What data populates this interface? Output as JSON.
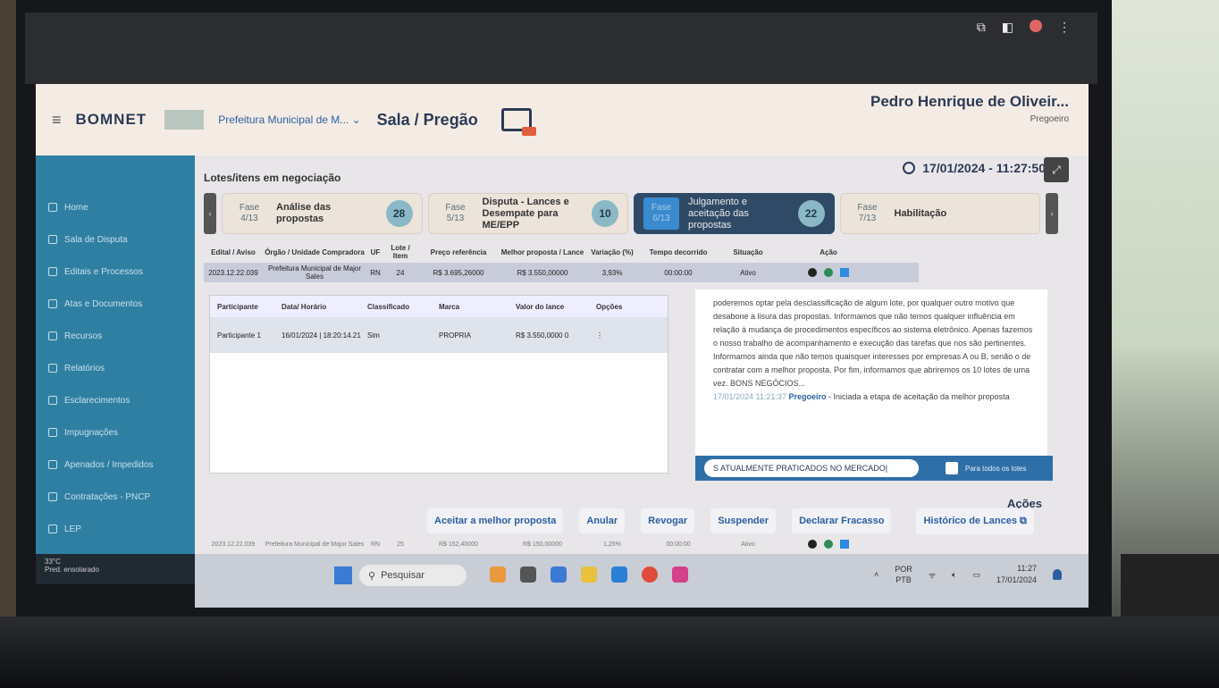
{
  "app": {
    "logo": "BOMNET",
    "org_select": "Prefeitura Municipal de M... ⌄",
    "page_heading": "Sala / Pregão",
    "user_name": "Pedro Henrique de Oliveir...",
    "user_role": "Pregoeiro"
  },
  "sidebar": {
    "items": [
      {
        "label": "Home"
      },
      {
        "label": "Sala de Disputa"
      },
      {
        "label": "Editais e Processos"
      },
      {
        "label": "Atas e Documentos"
      },
      {
        "label": "Recursos"
      },
      {
        "label": "Relatórios"
      },
      {
        "label": "Esclarecimentos"
      },
      {
        "label": "Impugnações"
      },
      {
        "label": "Apenados / Impedidos"
      },
      {
        "label": "Contratações - PNCP"
      },
      {
        "label": "LEP"
      }
    ]
  },
  "main": {
    "title": "Lotes/itens em negociação",
    "datetime": "17/01/2024 - 11:27:50",
    "phases": [
      {
        "label": "Fase 4/13",
        "name": "Análise das propostas",
        "count": "28"
      },
      {
        "label": "Fase 5/13",
        "name": "Disputa - Lances e Desempate para ME/EPP",
        "count": "10"
      },
      {
        "label": "Fase 6/13",
        "name": "Julgamento e aceitação das propostas",
        "count": "22"
      },
      {
        "label": "Fase 7/13",
        "name": "Habilitação",
        "count": ""
      }
    ],
    "lot_headers": [
      "Edital / Aviso",
      "Órgão / Unidade Compradora",
      "UF",
      "Lote / Item",
      "Preço referência",
      "Melhor proposta / Lance",
      "Variação (%)",
      "Tempo decorrido",
      "Situação",
      "Ação"
    ],
    "lot_row": [
      "2023.12.22.039",
      "Prefeitura Municipal de Major Sales",
      "RN",
      "24",
      "R$ 3.695,26000",
      "R$ 3.550,00000",
      "3,93%",
      "00:00:00",
      "Ativo"
    ],
    "lot_row2": [
      "2023.12.22.039",
      "Prefeitura Municipal de Major Sales",
      "RN",
      "25",
      "R$ 152,40000",
      "R$ 150,00000",
      "1,25%",
      "00:00:00",
      "Ativo"
    ],
    "bid_headers": [
      "Participante",
      "Data/ Horário",
      "Classificado",
      "Marca",
      "Valor do lance",
      "Opções"
    ],
    "bid_row": [
      "Participante 1",
      "16/01/2024 | 18:20:14.21",
      "Sim",
      "PROPRIA",
      "R$ 3.550,0000 0",
      "⋮"
    ],
    "chat_text": "poderemos optar pela desclassificação de algum lote, por qualquer outro motivo que desabone a lisura das propostas. Informamos que não temos qualquer influência em relação à mudança de procedimentos específicos ao sistema eletrônico. Apenas fazemos o nosso trabalho de acompanhamento e execução das tarefas que nos são pertinentes. Informamos ainda que não temos quaisquer interesses por empresas A ou B, senão o de contratar com a melhor proposta. Por fim, informamos que abriremos os 10 lotes de uma vez. BONS NEGÓCIOS...",
    "chat_time": "17/01/2024 11:21:37",
    "chat_author": "Pregoeiro",
    "chat_msg": " - Iniciada a etapa de aceitação da melhor proposta",
    "chat_input": "S ATUALMENTE PRATICADOS NO MERCADO|",
    "chat_all_lots": "Para todos os lotes",
    "actions_title": "Ações",
    "actions": [
      "Aceitar a melhor proposta",
      "Anular",
      "Revogar",
      "Suspender",
      "Declarar Fracasso",
      "Histórico de Lances ⧉"
    ]
  },
  "taskbar": {
    "weather_temp": "33°C",
    "weather_desc": "Pred. ensolarado",
    "search": "Pesquisar",
    "lang1": "POR",
    "lang2": "PTB",
    "time": "11:27",
    "date": "17/01/2024"
  }
}
